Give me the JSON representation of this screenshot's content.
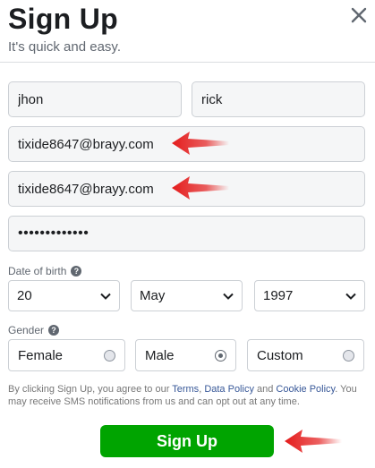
{
  "header": {
    "title": "Sign Up",
    "subtitle": "It's quick and easy."
  },
  "fields": {
    "first_name": "jhon",
    "last_name": "rick",
    "email": "tixide8647@brayy.com",
    "email_confirm": "tixide8647@brayy.com",
    "password": "•••••••••••••"
  },
  "dob": {
    "label": "Date of birth",
    "day": "20",
    "month": "May",
    "year": "1997"
  },
  "gender": {
    "label": "Gender",
    "options": [
      "Female",
      "Male",
      "Custom"
    ],
    "selected": "Male"
  },
  "terms": {
    "part1": "By clicking Sign Up, you agree to our ",
    "link_terms": "Terms",
    "sep1": ", ",
    "link_data": "Data Policy",
    "sep2": " and ",
    "link_cookie": "Cookie Policy",
    "part2": ". You may receive SMS notifications from us and can opt out at any time."
  },
  "button": {
    "signup_label": "Sign Up"
  },
  "icons": {
    "close": "close-icon",
    "help": "question-icon",
    "dropdown": "chevron-down-icon",
    "annotation": "red-arrow-icon"
  },
  "colors": {
    "primary_button": "#00a400",
    "link": "#385898",
    "annotation_arrow": "#e41c1c"
  }
}
